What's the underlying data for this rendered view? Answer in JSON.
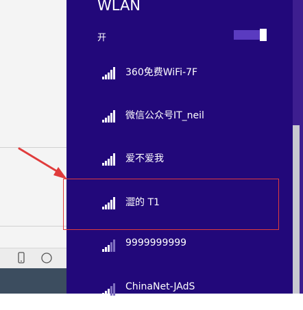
{
  "panel": {
    "title": "WLAN",
    "toggle_label": "开",
    "toggle_on": true
  },
  "networks": [
    {
      "name": "360免费WiFi-7F",
      "signal": "full"
    },
    {
      "name": "微信公众号IT_neil",
      "signal": "full"
    },
    {
      "name": "爱不爱我",
      "signal": "full"
    },
    {
      "name": "澀的 T1",
      "signal": "full"
    },
    {
      "name": "9999999999",
      "signal": "weak"
    },
    {
      "name": "ChinaNet-JAdS",
      "signal": "weak"
    }
  ],
  "taskbar_icons": [
    "phone-icon",
    "compass-icon"
  ],
  "colors": {
    "panel_bg": "#22087a",
    "toggle_track": "#5a3bc0",
    "highlight_border": "#e03c3c",
    "arrow": "#e03c3c"
  }
}
